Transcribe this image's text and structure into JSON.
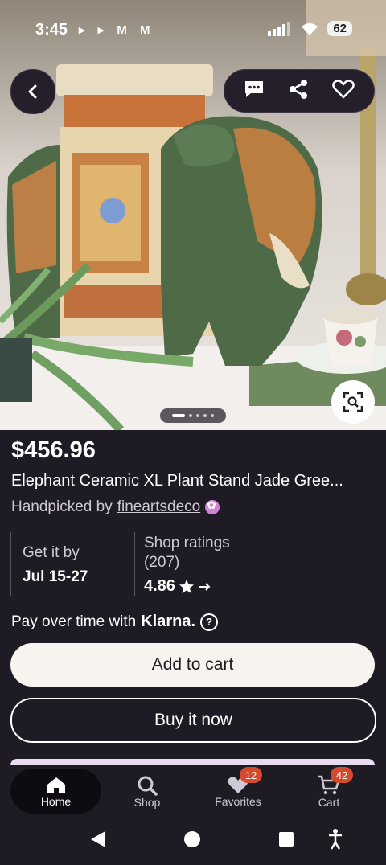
{
  "status": {
    "time": "3:45",
    "notif_icons": "▸ ▸ M M",
    "battery": "62"
  },
  "listing": {
    "price": "$456.96",
    "title": "Elephant Ceramic XL Plant Stand Jade Gree...",
    "handpicked_prefix": "Handpicked by",
    "shop_name": "fineartsdeco"
  },
  "delivery": {
    "label": "Get it by",
    "dates": "Jul 15-27"
  },
  "ratings": {
    "label": "Shop ratings",
    "count": "(207)",
    "value": "4.86"
  },
  "klarna": {
    "text": "Pay over time with",
    "brand": "Klarna."
  },
  "buttons": {
    "add_to_cart": "Add to cart",
    "buy_now": "Buy it now"
  },
  "nav": {
    "home": "Home",
    "shop": "Shop",
    "favorites": "Favorites",
    "favorites_badge": "12",
    "cart": "Cart",
    "cart_badge": "42"
  },
  "carousel": {
    "count": 5,
    "active_index": 0
  },
  "colors": {
    "background": "#1f1b24",
    "badge": "#d54a2e",
    "add_button": "#f7f3ee"
  }
}
